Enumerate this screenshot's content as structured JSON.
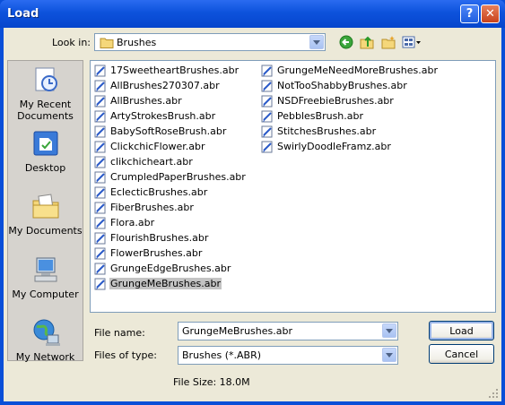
{
  "window": {
    "title": "Load",
    "help_label": "?",
    "close_label": "✕"
  },
  "look_in": {
    "label": "Look in:",
    "value": "Brushes"
  },
  "toolbar": {
    "icons": [
      "back-icon",
      "up-folder-icon",
      "new-folder-icon",
      "views-menu-icon"
    ]
  },
  "places": [
    {
      "label": "My Recent Documents",
      "icon": "recent-documents-icon"
    },
    {
      "label": "Desktop",
      "icon": "desktop-icon"
    },
    {
      "label": "My Documents",
      "icon": "my-documents-icon"
    },
    {
      "label": "My Computer",
      "icon": "my-computer-icon"
    },
    {
      "label": "My Network",
      "icon": "my-network-icon"
    }
  ],
  "files": {
    "col1": [
      "17SweetheartBrushes.abr",
      "AllBrushes270307.abr",
      "AllBrushes.abr",
      "ArtyStrokesBrush.abr",
      "BabySoftRoseBrush.abr",
      "ClickchicFlower.abr",
      "clikchicheart.abr",
      "CrumpledPaperBrushes.abr",
      "EclecticBrushes.abr",
      "FiberBrushes.abr",
      "Flora.abr",
      "FlourishBrushes.abr",
      "FlowerBrushes.abr",
      "GrungeEdgeBrushes.abr",
      "GrungeMeBrushes.abr"
    ],
    "col2": [
      "GrungeMeNeedMoreBrushes.abr",
      "NotTooShabbyBrushes.abr",
      "NSDFreebieBrushes.abr",
      "PebblesBrush.abr",
      "StitchesBrushes.abr",
      "SwirlyDoodleFramz.abr"
    ],
    "selected": "GrungeMeBrushes.abr"
  },
  "file_name": {
    "label": "File name:",
    "value": "GrungeMeBrushes.abr"
  },
  "file_type": {
    "label": "Files of type:",
    "value": "Brushes (*.ABR)"
  },
  "buttons": {
    "load": "Load",
    "cancel": "Cancel"
  },
  "file_size": "File Size:  18.0M",
  "colors": {
    "title_bar": "#0d52dc",
    "dialog_bg": "#ece9d8",
    "selection": "#c3c3c3"
  }
}
